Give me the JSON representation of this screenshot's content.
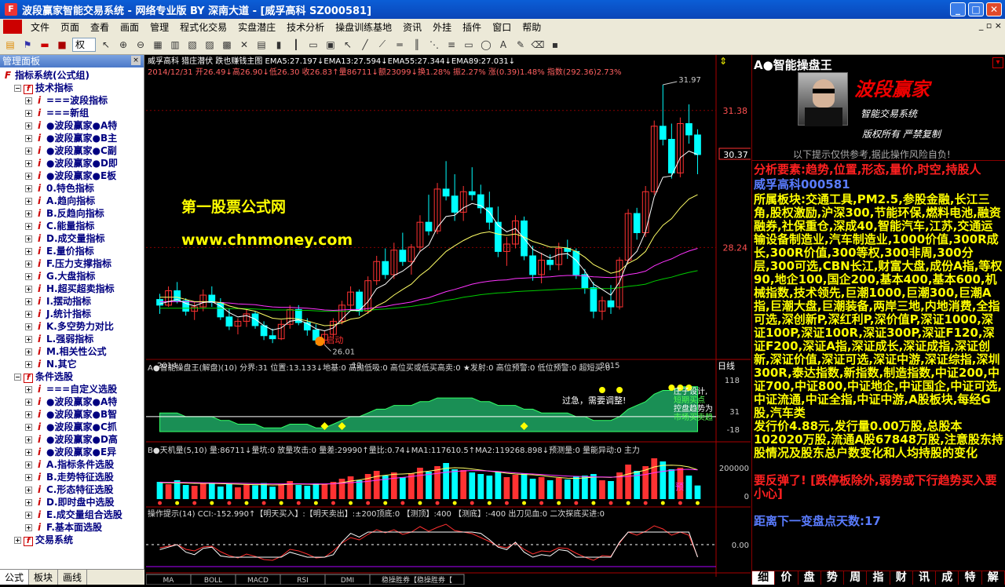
{
  "window": {
    "title": "波段赢家智能交易系统 - 网络专业版 BY 深南大道 - [威孚高科 SZ000581]"
  },
  "menu": [
    "文件",
    "页面",
    "查看",
    "画面",
    "管理",
    "程式化交易",
    "实盘潜庄",
    "技术分析",
    "操盘训练基地",
    "资讯",
    "外挂",
    "插件",
    "窗口",
    "帮助"
  ],
  "toolbar": {
    "period": "权"
  },
  "left_panel": {
    "title": "管理面板",
    "tree": [
      {
        "level": 0,
        "label": "指标系统(公式组)",
        "icon": "F"
      },
      {
        "level": 1,
        "label": "技术指标",
        "pm": "-"
      },
      {
        "level": 2,
        "label": "===波段指标",
        "pm": "+"
      },
      {
        "level": 2,
        "label": "===新组",
        "pm": "+"
      },
      {
        "level": 2,
        "label": "●波段赢家●A特",
        "pm": "+"
      },
      {
        "level": 2,
        "label": "●波段赢家●B主",
        "pm": "+"
      },
      {
        "level": 2,
        "label": "●波段赢家●C副",
        "pm": "+"
      },
      {
        "level": 2,
        "label": "●波段赢家●D即",
        "pm": "+"
      },
      {
        "level": 2,
        "label": "●波段赢家●E板",
        "pm": "+"
      },
      {
        "level": 2,
        "label": "0.特色指标",
        "pm": "+"
      },
      {
        "level": 2,
        "label": "A.趋向指标",
        "pm": "+"
      },
      {
        "level": 2,
        "label": "B.反趋向指标",
        "pm": "+"
      },
      {
        "level": 2,
        "label": "C.能量指标",
        "pm": "+"
      },
      {
        "level": 2,
        "label": "D.成交量指标",
        "pm": "+"
      },
      {
        "level": 2,
        "label": "E.量价指标",
        "pm": "+"
      },
      {
        "level": 2,
        "label": "F.压力支撑指标",
        "pm": "+"
      },
      {
        "level": 2,
        "label": "G.大盘指标",
        "pm": "+"
      },
      {
        "level": 2,
        "label": "H.超买超卖指标",
        "pm": "+"
      },
      {
        "level": 2,
        "label": "I.摆动指标",
        "pm": "+"
      },
      {
        "level": 2,
        "label": "J.统计指标",
        "pm": "+"
      },
      {
        "level": 2,
        "label": "K.多空势力对比",
        "pm": "+"
      },
      {
        "level": 2,
        "label": "L.强弱指标",
        "pm": "+"
      },
      {
        "level": 2,
        "label": "M.相关性公式",
        "pm": "+"
      },
      {
        "level": 2,
        "label": "N.其它",
        "pm": "+"
      },
      {
        "level": 1,
        "label": "条件选股",
        "pm": "-"
      },
      {
        "level": 2,
        "label": "===自定义选股",
        "pm": "+"
      },
      {
        "level": 2,
        "label": "●波段赢家●A特",
        "pm": "+"
      },
      {
        "level": 2,
        "label": "●波段赢家●B智",
        "pm": "+"
      },
      {
        "level": 2,
        "label": "●波段赢家●C抓",
        "pm": "+"
      },
      {
        "level": 2,
        "label": "●波段赢家●D高",
        "pm": "+"
      },
      {
        "level": 2,
        "label": "●波段赢家●E异",
        "pm": "+"
      },
      {
        "level": 2,
        "label": "A.指标条件选股",
        "pm": "+"
      },
      {
        "level": 2,
        "label": "B.走势特征选股",
        "pm": "+"
      },
      {
        "level": 2,
        "label": "C.形态特征选股",
        "pm": "+"
      },
      {
        "level": 2,
        "label": "D.即时盘中选股",
        "pm": "+"
      },
      {
        "level": 2,
        "label": "E.成交量组合选股",
        "pm": "+"
      },
      {
        "level": 2,
        "label": "F.基本面选股",
        "pm": "+"
      },
      {
        "level": 1,
        "label": "交易系统",
        "pm": "+"
      }
    ],
    "tabs": [
      "公式",
      "板块",
      "画线"
    ]
  },
  "main_chart": {
    "header": "威孚高科  猎庄潜伏  跌也赚钱主图  EMA5:27.197↓EMA13:27.594↓EMA55:27.344↓EMA89:27.031↓",
    "info": "2014/12/31  开26.49↓高26.90↓低26.30  收26.83↑量86711↓额23099↓换1.28% 振2.27% 涨(0.39)1.48% 指数(292.36)2.73%",
    "price_labels": [
      "31.38",
      "28.24"
    ],
    "current_price": "30.37",
    "high_label": "31.97",
    "low_label": "26.01",
    "start_label": "启动",
    "watermark1": "第一股票公式网",
    "watermark2": "www.chnmoney.com",
    "dates": [
      "2014",
      "12",
      "2015"
    ],
    "day_label": "日线"
  },
  "ind1": {
    "header": "A●智能操盘王(解盘)(10) 分界:31  位置:13.133↓地基:0  高抛低吸:0  高位买或低买高卖:0 ★发射:0  高位预警:0 低位预警:0  超短买:0",
    "scale": [
      "118",
      "31",
      "-18"
    ],
    "note": "过急，需要调整!",
    "labels": [
      "庄子设计,",
      "短期买点",
      "控盘趋势为",
      "市场买卖趋"
    ]
  },
  "ind2": {
    "header": "B●天机量(5,10)  量:86711↓量坑:0  放量攻击:0  量差:29990↑量比:0.74↓MA1:117610.5↑MA2:119268.898↓预测量:0 量能异动:0 主力",
    "scale": [
      "200000",
      "0"
    ],
    "tag": "预"
  },
  "ind3": {
    "header": "操作提示(14)  CCI:-152.990↑【明天买入】:【明天卖出】:±200顶底:0  【测顶】:400  【测底】:-400  出刀见血:0  二次探底买进:0",
    "scale": [
      "0.00"
    ]
  },
  "bottom_tabs": [
    "MA",
    "BOLL",
    "MACD",
    "RSI",
    "DMI",
    "稳操胜券【稳操胜券【"
  ],
  "right_panel": {
    "title": "A●智能操盘王",
    "logo_title": "波段赢家",
    "logo_sub": "智能交易系统",
    "logo_copy": "版权所有  严禁复制",
    "notice": "以下提示仅供参考,据此操作风险自负!",
    "factors": "分析要素:趋势,位置,形态,量价,时空,持股人",
    "stock": "威孚高科000581",
    "sector": "所属板块:交通工具,PM2.5,参股金融,长江三角,股权激励,沪深300,节能环保,燃料电池,融资融券,社保重仓,深成40,智能汽车,江苏,交通运输设备制造业,汽车制造业,1000价值,300R成长,300R价值,300等权,300非周,300分层,300可选,CBN长江,财富大盘,成份A指,等权90,地企100,国企200,基本400,基本600,机械指数,技术领先,巨潮1000,巨潮300,巨潮A指,巨潮大盘,巨潮装备,两岸三地,内地消费,全指可选,深创新P,深红利P,深价值P,深证1000,深证100P,深证100R,深证300P,深证F120,深证F200,深证A指,深证成长,深证成指,深证创新,深证价值,深证可选,深证中游,深证综指,深圳300R,泰达指数,新指数,制造指数,中证200,中证700,中证800,中证地企,中证国企,中证可选,中证流通,中证全指,中证中游,A股板块,每经G股,汽车类",
    "shares": "发行价4.88元,发行量0.00万股,总股本102020万股,流通A股67848万股,注意股东持股情况及股东总户数变化和人均持股的变化",
    "rebound": "要反弹了! [跌停板除外,弱势或下行趋势买入要小心]",
    "countdown": "距离下一变盘点天数:17",
    "bottom": [
      "细",
      "价",
      "盘",
      "势",
      "周",
      "指",
      "财",
      "讯",
      "成",
      "特",
      "解"
    ]
  },
  "colors": {
    "up": "#ff3232",
    "down": "#00ffff",
    "ema5": "#ffffff",
    "ema13": "#ffff66",
    "ema55": "#ff33ff",
    "ema89": "#00cc00",
    "title_yellow": "#ffff00",
    "red_text": "#ff2020",
    "blue_text": "#5a7cff"
  },
  "chart_data": {
    "type": "candlestick",
    "candles": [
      [
        27.05,
        27.18,
        26.72,
        26.92
      ],
      [
        26.92,
        27.35,
        26.88,
        27.25
      ],
      [
        27.25,
        27.45,
        26.96,
        27.02
      ],
      [
        27.02,
        27.08,
        26.68,
        26.78
      ],
      [
        26.78,
        26.98,
        26.58,
        26.88
      ],
      [
        26.88,
        27.28,
        26.78,
        27.15
      ],
      [
        27.15,
        27.35,
        26.88,
        26.98
      ],
      [
        26.98,
        27.08,
        26.58,
        26.65
      ],
      [
        26.65,
        26.84,
        26.35,
        26.44
      ],
      [
        26.44,
        26.62,
        26.25,
        26.55
      ],
      [
        26.55,
        26.82,
        26.42,
        26.72
      ],
      [
        26.72,
        26.78,
        26.38,
        26.45
      ],
      [
        26.45,
        26.55,
        26.12,
        26.22
      ],
      [
        26.22,
        26.38,
        26.05,
        26.15
      ],
      [
        26.15,
        26.58,
        26.12,
        26.48
      ],
      [
        26.48,
        26.92,
        26.38,
        26.82
      ],
      [
        26.82,
        26.92,
        26.46,
        26.52
      ],
      [
        26.52,
        26.62,
        26.22,
        26.35
      ],
      [
        26.35,
        26.48,
        26.02,
        26.12
      ],
      [
        26.12,
        26.32,
        26.01,
        26.25
      ],
      [
        26.25,
        26.62,
        26.18,
        26.55
      ],
      [
        26.55,
        27.02,
        26.48,
        26.92
      ],
      [
        26.92,
        27.35,
        26.82,
        27.22
      ],
      [
        27.22,
        27.28,
        26.68,
        26.78
      ],
      [
        26.78,
        27.58,
        26.72,
        27.48
      ],
      [
        27.48,
        28.05,
        27.38,
        27.92
      ],
      [
        27.92,
        28.22,
        27.52,
        27.62
      ],
      [
        27.62,
        28.35,
        27.52,
        28.18
      ],
      [
        28.18,
        28.58,
        27.82,
        27.92
      ],
      [
        27.92,
        28.32,
        27.62,
        28.25
      ],
      [
        28.25,
        28.98,
        28.15,
        28.82
      ],
      [
        28.82,
        29.45,
        28.52,
        28.62
      ],
      [
        28.62,
        29.72,
        28.55,
        29.58
      ],
      [
        29.58,
        30.22,
        29.32,
        29.42
      ],
      [
        29.42,
        29.92,
        28.85,
        29.05
      ],
      [
        29.05,
        29.65,
        28.85,
        29.52
      ],
      [
        29.52,
        30.08,
        29.32,
        29.45
      ],
      [
        29.45,
        29.68,
        29.02,
        29.15
      ],
      [
        29.15,
        29.52,
        28.65,
        28.82
      ],
      [
        28.82,
        29.18,
        28.02,
        28.15
      ],
      [
        28.15,
        28.48,
        27.82,
        28.32
      ],
      [
        28.32,
        28.98,
        28.22,
        28.85
      ],
      [
        28.85,
        28.95,
        27.95,
        28.05
      ],
      [
        28.05,
        28.28,
        27.48,
        27.62
      ],
      [
        27.62,
        28.12,
        27.42,
        27.95
      ],
      [
        27.95,
        28.08,
        27.72,
        27.85
      ],
      [
        27.85,
        28.35,
        27.72,
        28.22
      ],
      [
        28.22,
        28.42,
        27.98,
        28.15
      ],
      [
        28.15,
        28.22,
        27.52,
        27.62
      ],
      [
        27.62,
        27.75,
        27.18,
        27.32
      ],
      [
        27.32,
        27.45,
        26.62,
        26.78
      ],
      [
        26.78,
        27.12,
        26.58,
        27.02
      ],
      [
        27.02,
        27.38,
        26.72,
        26.88
      ],
      [
        26.88,
        28.02,
        26.82,
        27.95
      ],
      [
        27.95,
        29.12,
        27.88,
        29.02
      ],
      [
        29.02,
        29.15,
        28.42,
        28.58
      ],
      [
        28.58,
        29.65,
        28.48,
        29.52
      ],
      [
        29.52,
        31.15,
        29.45,
        31.02
      ],
      [
        31.02,
        31.97,
        30.58,
        30.72
      ],
      [
        30.72,
        31.08,
        29.82,
        29.95
      ],
      [
        29.95,
        31.22,
        29.85,
        31.08
      ],
      [
        31.08,
        31.52,
        30.62,
        30.82
      ],
      [
        30.82,
        30.95,
        29.92,
        30.37
      ]
    ],
    "ylim": [
      26.0,
      31.97
    ],
    "ema5": [
      26.95,
      27.0,
      27.05,
      26.96,
      26.9,
      26.98,
      27.0,
      26.9,
      26.75,
      26.65,
      26.68,
      26.6,
      26.45,
      26.35,
      26.4,
      26.55,
      26.58,
      26.5,
      26.38,
      26.33,
      26.4,
      26.6,
      26.8,
      26.8,
      27.0,
      27.3,
      27.4,
      27.6,
      27.7,
      27.85,
      28.15,
      28.3,
      28.7,
      28.95,
      28.98,
      29.15,
      29.25,
      29.2,
      29.05,
      28.75,
      28.6,
      28.68,
      28.45,
      28.2,
      28.1,
      28.0,
      28.08,
      28.1,
      27.95,
      27.7,
      27.4,
      27.28,
      27.15,
      27.45,
      27.95,
      28.15,
      28.6,
      29.4,
      29.85,
      29.88,
      30.3,
      30.45,
      30.37
    ],
    "ema13": [
      27.1,
      27.1,
      27.1,
      27.05,
      27.0,
      27.0,
      27.0,
      26.98,
      26.9,
      26.85,
      26.82,
      26.78,
      26.7,
      26.62,
      26.6,
      26.62,
      26.6,
      26.56,
      26.5,
      26.45,
      26.46,
      26.52,
      26.6,
      26.63,
      26.75,
      26.9,
      27.0,
      27.15,
      27.28,
      27.4,
      27.6,
      27.75,
      27.95,
      28.15,
      28.28,
      28.4,
      28.5,
      28.57,
      28.6,
      28.55,
      28.52,
      28.55,
      28.48,
      28.38,
      28.32,
      28.25,
      28.25,
      28.23,
      28.15,
      28.02,
      27.85,
      27.75,
      27.65,
      27.7,
      27.88,
      27.98,
      28.15,
      28.5,
      28.75,
      28.9,
      29.15,
      29.35,
      29.45
    ],
    "ema55": [
      27.0,
      27.0,
      27.0,
      27.0,
      26.99,
      26.99,
      26.99,
      26.98,
      26.97,
      26.95,
      26.94,
      26.93,
      26.9,
      26.88,
      26.87,
      26.87,
      26.86,
      26.85,
      26.83,
      26.81,
      26.8,
      26.81,
      26.82,
      26.82,
      26.84,
      26.87,
      26.89,
      26.93,
      26.96,
      26.99,
      27.05,
      27.09,
      27.16,
      27.23,
      27.28,
      27.34,
      27.4,
      27.44,
      27.47,
      27.49,
      27.5,
      27.53,
      27.54,
      27.55,
      27.56,
      27.57,
      27.59,
      27.6,
      27.6,
      27.59,
      27.57,
      27.56,
      27.55,
      27.57,
      27.62,
      27.65,
      27.7,
      27.82,
      27.91,
      27.98,
      28.08,
      28.16,
      28.22
    ],
    "ema89": [
      26.85,
      26.85,
      26.85,
      26.85,
      26.85,
      26.85,
      26.85,
      26.85,
      26.84,
      26.84,
      26.84,
      26.83,
      26.82,
      26.81,
      26.81,
      26.81,
      26.8,
      26.8,
      26.79,
      26.78,
      26.78,
      26.78,
      26.79,
      26.79,
      26.8,
      26.82,
      26.83,
      26.85,
      26.87,
      26.89,
      26.92,
      26.95,
      26.99,
      27.03,
      27.06,
      27.1,
      27.13,
      27.16,
      27.18,
      27.2,
      27.21,
      27.23,
      27.24,
      27.25,
      27.26,
      27.27,
      27.28,
      27.29,
      27.3,
      27.3,
      27.3,
      27.3,
      27.3,
      27.32,
      27.35,
      27.37,
      27.4,
      27.47,
      27.52,
      27.56,
      27.62,
      27.67,
      27.71
    ],
    "ind1": [
      5,
      5,
      5,
      4,
      4,
      4,
      4,
      3,
      3,
      2,
      2,
      2,
      1,
      1,
      1,
      2,
      2,
      2,
      1,
      1,
      2,
      3,
      4,
      4,
      5,
      6,
      6,
      7,
      7,
      7,
      8,
      8,
      9,
      9,
      9,
      9,
      9,
      8,
      8,
      7,
      7,
      7,
      6,
      6,
      5,
      5,
      5,
      5,
      4,
      4,
      3,
      3,
      3,
      4,
      6,
      7,
      8,
      10,
      11,
      11,
      12,
      12,
      12
    ],
    "volume": [
      110000,
      95000,
      120000,
      90000,
      85000,
      100000,
      105000,
      80000,
      98000,
      75000,
      92000,
      88000,
      102000,
      79000,
      96000,
      115000,
      90000,
      85000,
      100000,
      95000,
      110000,
      130000,
      145000,
      120000,
      160000,
      180000,
      150000,
      170000,
      140000,
      165000,
      200000,
      175000,
      210000,
      230000,
      190000,
      185000,
      170000,
      160000,
      150000,
      175000,
      140000,
      155000,
      165000,
      130000,
      140000,
      120000,
      135000,
      125000,
      145000,
      150000,
      160000,
      120000,
      115000,
      170000,
      220000,
      180000,
      210000,
      260000,
      240000,
      190000,
      200000,
      150000,
      86711
    ],
    "vol_ma1": [
      105000,
      103000,
      104000,
      102000,
      100000,
      100000,
      100000,
      98000,
      97000,
      95000,
      93000,
      92000,
      92000,
      90000,
      91000,
      95000,
      96000,
      95000,
      94000,
      95000,
      98000,
      105000,
      115000,
      122000,
      132000,
      145000,
      152000,
      158000,
      160000,
      163000,
      172000,
      178000,
      186000,
      196000,
      200000,
      198000,
      192000,
      185000,
      178000,
      172000,
      165000,
      160000,
      157000,
      155000,
      150000,
      143000,
      138000,
      133000,
      132000,
      135000,
      140000,
      140000,
      138000,
      145000,
      160000,
      172000,
      185000,
      205000,
      215000,
      216000,
      214000,
      205000,
      187000
    ],
    "vol_ma2": [
      108000,
      107000,
      107000,
      106000,
      105000,
      104000,
      104000,
      103000,
      102000,
      101000,
      100000,
      99000,
      98000,
      97000,
      97000,
      98000,
      98000,
      97000,
      97000,
      97000,
      98000,
      101000,
      105000,
      108000,
      113000,
      120000,
      126000,
      133000,
      138000,
      144000,
      151000,
      157000,
      164000,
      171000,
      176000,
      180000,
      182000,
      181000,
      179000,
      176000,
      171000,
      167000,
      163000,
      160000,
      157000,
      153000,
      150000,
      147000,
      145000,
      143000,
      142000,
      141000,
      140000,
      141000,
      145000,
      150000,
      157000,
      168000,
      177000,
      183000,
      188000,
      190000,
      186000
    ],
    "cci": [
      -40,
      -20,
      0,
      -60,
      -80,
      -30,
      -20,
      -90,
      -140,
      -170,
      -120,
      -150,
      -190,
      -200,
      -150,
      -60,
      -80,
      -120,
      -170,
      -160,
      -80,
      20,
      90,
      60,
      130,
      190,
      150,
      190,
      130,
      160,
      230,
      170,
      220,
      260,
      180,
      160,
      140,
      90,
      40,
      -20,
      -40,
      20,
      -60,
      -120,
      -80,
      -90,
      -40,
      -50,
      -110,
      -160,
      -200,
      -140,
      -150,
      20,
      160,
      120,
      170,
      240,
      200,
      120,
      160,
      120,
      -153
    ]
  }
}
